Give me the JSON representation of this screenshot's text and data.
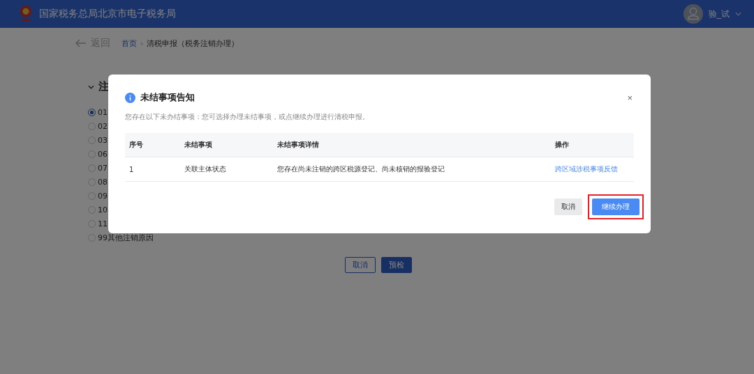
{
  "header": {
    "title": "国家税务总局北京市电子税务局",
    "user_name": "验_试"
  },
  "nav": {
    "back": "返回",
    "breadcrumb": [
      "首页",
      "清税申报（税务注销办理）"
    ],
    "separator": "›"
  },
  "form": {
    "section_title": "注",
    "options": [
      {
        "label": "01",
        "selected": true
      },
      {
        "label": "02",
        "selected": false
      },
      {
        "label": "03",
        "selected": false
      },
      {
        "label": "06",
        "selected": false
      },
      {
        "label": "07",
        "selected": false
      },
      {
        "label": "08",
        "selected": false
      },
      {
        "label": "09",
        "selected": false
      },
      {
        "label": "10",
        "selected": false
      },
      {
        "label": "11",
        "selected": false
      },
      {
        "label": "99其他注销原因",
        "selected": false
      }
    ],
    "buttons": [
      "取消",
      "预检"
    ]
  },
  "dialog": {
    "title": "未结事项告知",
    "message": "您存在以下未办结事项：您可选择办理未结事项，或点继续办理进行清税申报。",
    "close": "×",
    "table": {
      "columns": [
        "序号",
        "未结事项",
        "未结事项详情",
        "操作"
      ],
      "rows": [
        {
          "index": "1",
          "item": "关联主体状态",
          "detail": "您存在尚未注销的跨区税源登记、尚未核销的报验登记",
          "action": "跨区域涉税事项反馈"
        }
      ]
    },
    "buttons": [
      {
        "label": "取消",
        "kind": "secondary",
        "highlighted": false
      },
      {
        "label": "继续办理",
        "kind": "primary",
        "highlighted": true
      }
    ]
  }
}
